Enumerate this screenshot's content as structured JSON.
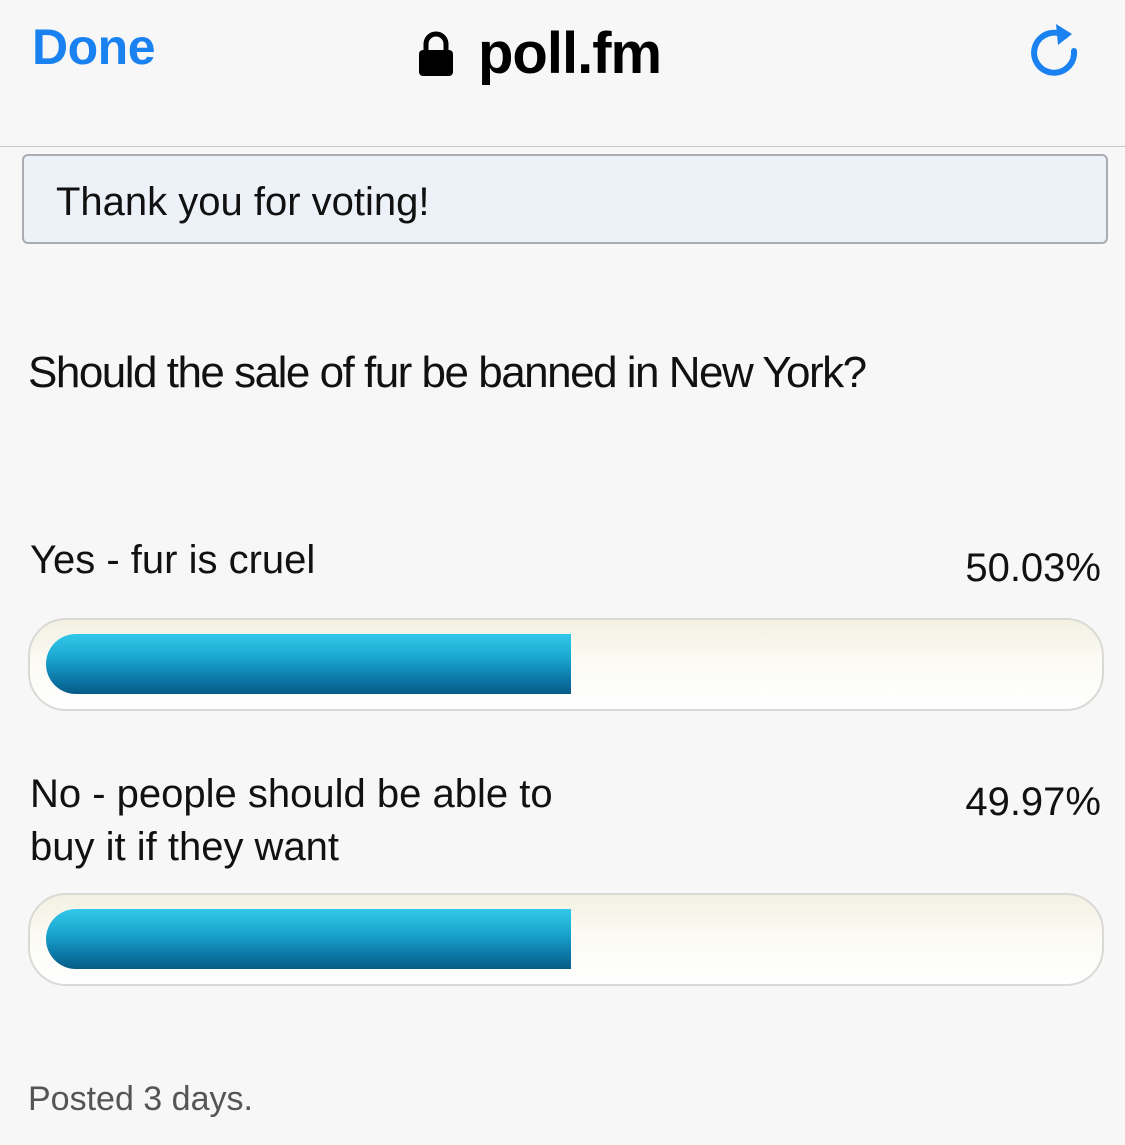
{
  "navbar": {
    "done_label": "Done",
    "url": "poll.fm",
    "lock_icon": "lock-icon",
    "reload_icon": "reload-icon",
    "accent_color": "#1a82f0"
  },
  "notice": {
    "text": "Thank you for voting!"
  },
  "poll": {
    "question": "Should the sale of fur be banned in New York?",
    "options": [
      {
        "label": "Yes - fur is cruel",
        "percent_text": "50.03%",
        "percent": 50.03
      },
      {
        "label": "No - people should be able to buy it if they want",
        "percent_text": "49.97%",
        "percent": 49.97
      }
    ],
    "bar_color": "#1aa6cf"
  },
  "footer": {
    "posted": "Posted 3 days."
  }
}
